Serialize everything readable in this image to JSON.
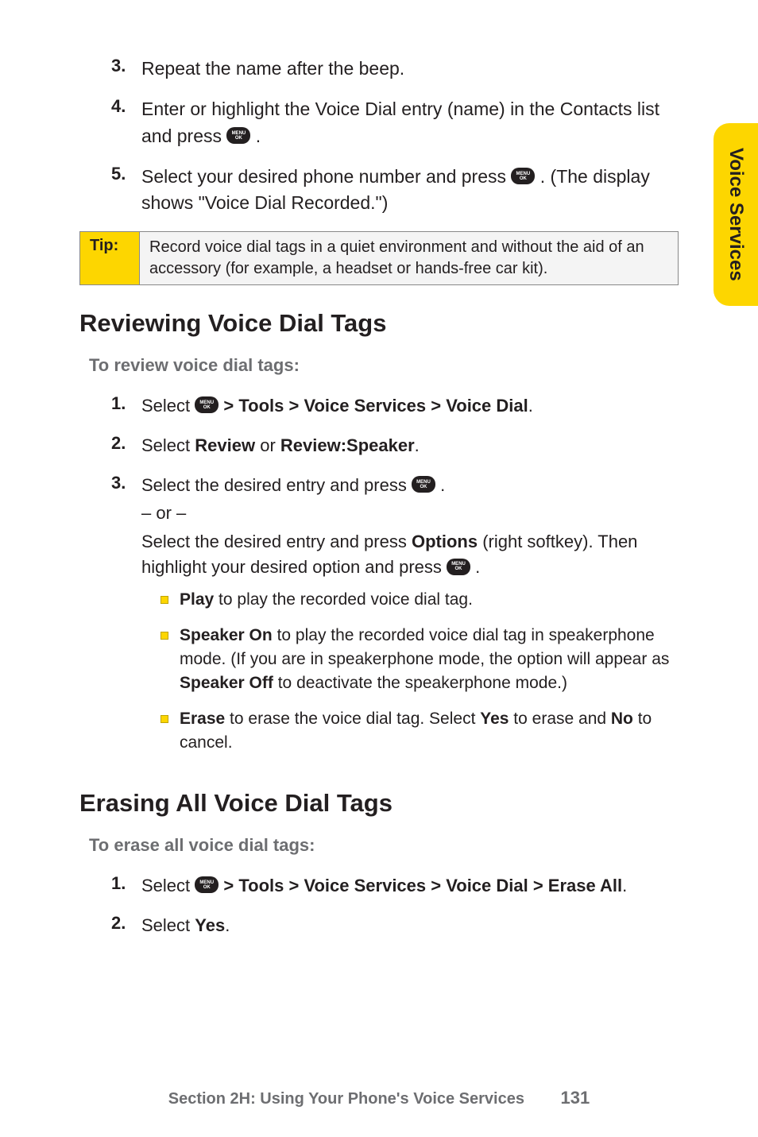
{
  "side_tab": "Voice Services",
  "top_steps": [
    {
      "num": "3.",
      "text": "Repeat the name after the beep."
    },
    {
      "num": "4.",
      "text_before": "Enter or highlight the Voice Dial entry (name) in the Contacts list and press ",
      "text_after": " ."
    },
    {
      "num": "5.",
      "text_before": "Select your desired phone number and press ",
      "text_after": " . (The display shows \"Voice Dial Recorded.\")"
    }
  ],
  "tip": {
    "label": "Tip:",
    "text": "Record voice dial tags in a quiet environment and without the aid of an accessory (for example, a headset or hands-free car kit)."
  },
  "section1": {
    "heading": "Reviewing Voice Dial Tags",
    "subheading": "To review voice dial tags:",
    "steps": {
      "s1": {
        "num": "1.",
        "before": "Select ",
        "path": " > Tools > Voice Services > Voice Dial",
        "after": "."
      },
      "s2": {
        "num": "2.",
        "before": "Select ",
        "b1": "Review",
        "mid": " or ",
        "b2": "Review:Speaker",
        "after": "."
      },
      "s3": {
        "num": "3.",
        "line1_before": "Select the desired entry and press ",
        "line1_after": " .",
        "or": "– or –",
        "line2_before": "Select the desired entry and press ",
        "line2_b": "Options",
        "line2_mid": " (right softkey). Then highlight your desired option and press ",
        "line2_after": " ."
      }
    },
    "bullets": [
      {
        "b": "Play",
        "rest": " to play the recorded voice dial tag."
      },
      {
        "b": "Speaker On",
        "rest": " to play the recorded voice dial tag in speakerphone mode. (If you are in speakerphone mode, the option will appear as ",
        "b2": "Speaker Off",
        "rest2": " to deactivate the speakerphone mode.)"
      },
      {
        "b": "Erase",
        "rest": " to erase the voice dial tag. Select ",
        "b2": "Yes",
        "rest2": " to erase and ",
        "b3": "No",
        "rest3": " to cancel."
      }
    ]
  },
  "section2": {
    "heading": "Erasing All Voice Dial Tags",
    "subheading": "To erase all voice dial tags:",
    "steps": {
      "s1": {
        "num": "1.",
        "before": "Select ",
        "path": " > Tools > Voice Services > Voice Dial > Erase All",
        "after": "."
      },
      "s2": {
        "num": "2.",
        "before": "Select ",
        "b": "Yes",
        "after": "."
      }
    }
  },
  "footer": {
    "text": "Section 2H: Using Your Phone's Voice Services",
    "page_number": "131"
  },
  "icon": {
    "top": "MENU",
    "bottom": "OK"
  }
}
